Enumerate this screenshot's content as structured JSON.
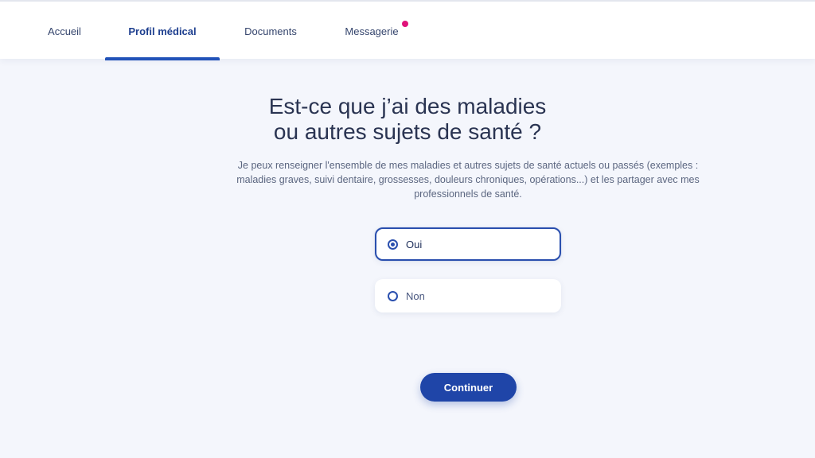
{
  "nav": {
    "tabs": [
      {
        "label": "Accueil"
      },
      {
        "label": "Profil médical",
        "active": true
      },
      {
        "label": "Documents"
      },
      {
        "label": "Messagerie",
        "notification": true
      }
    ]
  },
  "question": {
    "title_line1": "Est-ce que j’ai des maladies",
    "title_line2": "ou autres sujets de santé ?",
    "description": "Je peux renseigner l'ensemble de mes maladies et autres sujets de santé actuels ou passés (exemples : maladies graves, suivi dentaire, grossesses, douleurs chroniques, opérations...) et les partager avec mes professionnels de santé."
  },
  "options": [
    {
      "label": "Oui",
      "selected": true
    },
    {
      "label": "Non",
      "selected": false
    }
  ],
  "actions": {
    "continue_label": "Continuer"
  },
  "colors": {
    "accent": "#1f45a8",
    "notification": "#e0127a",
    "background": "#f4f6fc"
  }
}
